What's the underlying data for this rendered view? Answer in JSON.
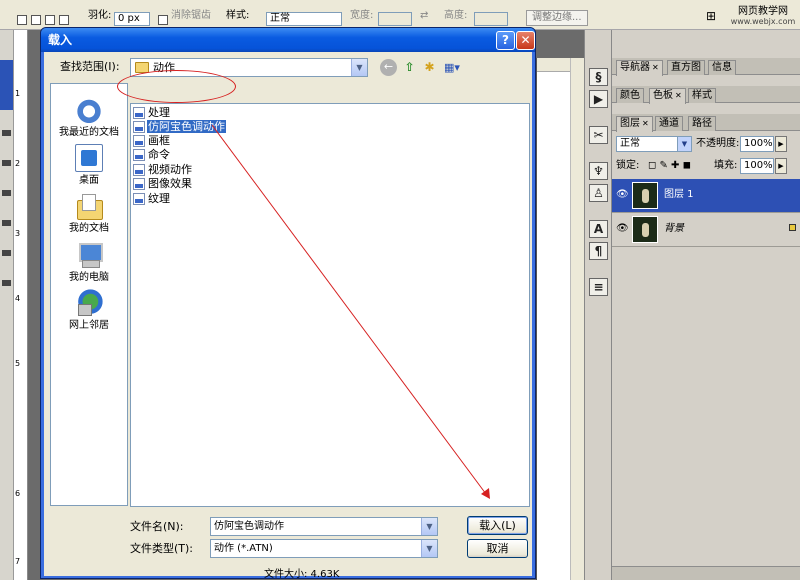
{
  "photoshop": {
    "options_bar": {
      "feather_label": "羽化:",
      "feather_value": "0 px",
      "antialias_label": "消除锯齿",
      "style_label": "样式:",
      "style_value": "正常",
      "width_label": "宽度:",
      "height_label": "高度:",
      "refine_edge_label": "调整边缘..."
    },
    "watermark": {
      "line1": "网页教学网",
      "line2": "www.webjx.com"
    },
    "ruler_numbers": [
      "1",
      "2",
      "3",
      "4",
      "5",
      "6",
      "7"
    ],
    "panels": {
      "group1_tabs": [
        "导航器",
        "直方图",
        "信息"
      ],
      "group2_tabs": [
        "颜色",
        "色板",
        "样式"
      ],
      "group3_tabs": [
        "图层",
        "通道",
        "路径"
      ],
      "blend_mode": "正常",
      "opacity_label": "不透明度:",
      "opacity_value": "100%",
      "lock_label": "锁定:",
      "fill_label": "填充:",
      "fill_value": "100%",
      "layers": [
        {
          "name": "图层 1",
          "selected": true
        },
        {
          "name": "背景",
          "selected": false
        }
      ]
    }
  },
  "dialog": {
    "title": "载入",
    "look_in_label": "查找范围(I):",
    "look_in_value": "动作",
    "places": [
      "我最近的文档",
      "桌面",
      "我的文档",
      "我的电脑",
      "网上邻居"
    ],
    "files": [
      "处理",
      "仿阿宝色调动作",
      "画框",
      "命令",
      "视频动作",
      "图像效果",
      "纹理"
    ],
    "selected_file": "仿阿宝色调动作",
    "file_name_label": "文件名(N):",
    "file_name_value": "仿阿宝色调动作",
    "file_type_label": "文件类型(T):",
    "file_type_value": "动作 (*.ATN)",
    "load_button": "载入(L)",
    "cancel_button": "取消",
    "file_size": "文件大小: 4.63K"
  },
  "colors": {
    "title_bar": "#0653d9",
    "selection": "#316ac5",
    "annotation_red": "#d62020"
  }
}
